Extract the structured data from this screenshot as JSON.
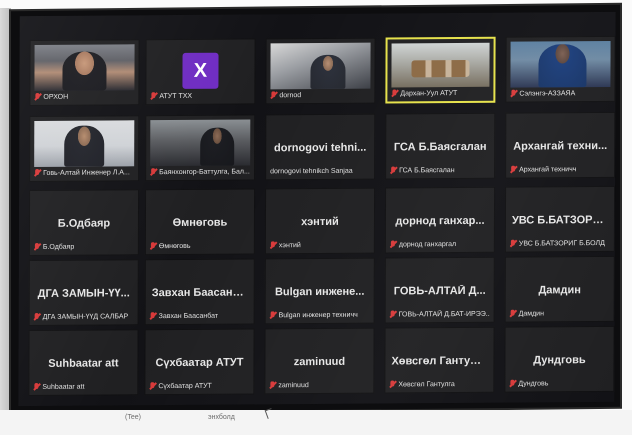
{
  "meeting": {
    "tiles": [
      {
        "id": "orkhon",
        "label": "ОРХОН",
        "type": "video",
        "feed": "feed-orkhon",
        "muted": true,
        "active": false
      },
      {
        "id": "atut-tkh",
        "label": "АТУТ ТХХ",
        "type": "avatar",
        "avatar_letter": "X",
        "avatar_color": "#6f2cc2",
        "muted": true,
        "active": false
      },
      {
        "id": "dornod",
        "label": "dornod",
        "type": "video",
        "feed": "feed-dornod",
        "muted": true,
        "active": false
      },
      {
        "id": "darkhan-uul",
        "label": "Дархан-Уул АТУТ",
        "type": "video",
        "feed": "feed-darkhan",
        "muted": true,
        "active": true
      },
      {
        "id": "selenge",
        "label": "Сэлэнгэ-АЗЗАЯА",
        "type": "video",
        "feed": "feed-selenge",
        "muted": true,
        "active": false
      },
      {
        "id": "govi-altai-eng",
        "label": "Говь-Алтай Инженер Л.А...",
        "type": "video",
        "feed": "feed-govi-altai",
        "muted": true,
        "active": false
      },
      {
        "id": "bayankhongor",
        "label": "Баянхонгор-Баттулга, Бал...",
        "type": "video",
        "feed": "feed-bayankhongor",
        "muted": true,
        "active": false
      },
      {
        "id": "dornogovi",
        "name": "dornogovi tehni...",
        "label": "dornogovi tehnikch Sanjaa",
        "type": "name",
        "muted": false,
        "active": false
      },
      {
        "id": "gsa",
        "name": "ГСА Б.Баясгалан",
        "label": "ГСА Б.Баясгалан",
        "type": "name",
        "muted": true,
        "active": false
      },
      {
        "id": "arkhangai",
        "name": "Архангай техни...",
        "label": "Архангай техничч",
        "type": "name",
        "muted": true,
        "active": false
      },
      {
        "id": "odbayar",
        "name": "Б.Одбаяр",
        "label": "Б.Одбаяр",
        "type": "name",
        "muted": true,
        "active": false
      },
      {
        "id": "umnugovi",
        "name": "Өмнөговь",
        "label": "Өмнөговь",
        "type": "name",
        "muted": true,
        "active": false
      },
      {
        "id": "khentii",
        "name": "хэнтий",
        "label": "хэнтий",
        "type": "name",
        "muted": true,
        "active": false
      },
      {
        "id": "dornod-gankhargal",
        "name": "дорнод ганхар...",
        "label": "дорнод ганхаргал",
        "type": "name",
        "muted": true,
        "active": false
      },
      {
        "id": "uvs",
        "name": "УВС Б.БАТЗОРИ...",
        "label": "УВС Б.БАТЗОРИГ Б.БОЛД",
        "type": "name",
        "muted": true,
        "active": false
      },
      {
        "id": "dga-zamyn",
        "name": "ДГА ЗАМЫН-ҮҮ...",
        "label": "ДГА ЗАМЫН-ҮҮД САЛБАР",
        "type": "name",
        "muted": true,
        "active": false
      },
      {
        "id": "zavkhan",
        "name": "Завхан Баасанбат",
        "label": "Завхан Баасанбат",
        "type": "name",
        "muted": true,
        "active": false
      },
      {
        "id": "bulgan",
        "name": "Bulgan инжене...",
        "label": "Bulgan инженер техничч",
        "type": "name",
        "muted": true,
        "active": false
      },
      {
        "id": "govi-altai-d",
        "name": "ГОВЬ-АЛТАЙ Д...",
        "label": "ГОВЬ-АЛТАЙ Д.БАТ-ИРЭЭ...",
        "type": "name",
        "muted": true,
        "active": false
      },
      {
        "id": "damdin",
        "name": "Дамдин",
        "label": "Дамдин",
        "type": "name",
        "muted": true,
        "active": false
      },
      {
        "id": "suhbaatar",
        "name": "Suhbaatar att",
        "label": "Suhbaatar att",
        "type": "name",
        "muted": true,
        "active": false
      },
      {
        "id": "sukhbaatar-atut",
        "name": "Сүхбаатар АТУТ",
        "label": "Сүхбаатар АТУТ",
        "type": "name",
        "muted": true,
        "active": false
      },
      {
        "id": "zaminuud",
        "name": "zaminuud",
        "label": "zaminuud",
        "type": "name",
        "muted": true,
        "active": false
      },
      {
        "id": "khuvsgul",
        "name": "Хөвсгөл Гантулга",
        "label": "Хөвсгөл Гантулга",
        "type": "name",
        "muted": true,
        "active": false
      },
      {
        "id": "dundgovi",
        "name": "Дундговь",
        "label": "Дундговь",
        "type": "name",
        "muted": true,
        "active": false
      }
    ]
  },
  "below_screen": {
    "left_text": "(Tee)",
    "center_text": "энхболд"
  }
}
